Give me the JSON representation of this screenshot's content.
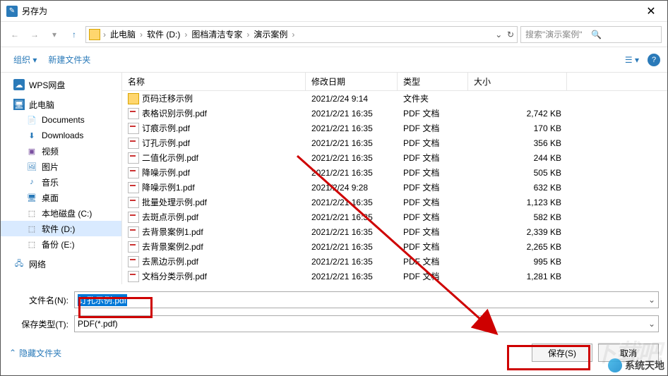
{
  "window": {
    "title": "另存为"
  },
  "breadcrumb": {
    "items": [
      "此电脑",
      "软件 (D:)",
      "图档清洁专家",
      "演示案例"
    ]
  },
  "search": {
    "placeholder": "搜索\"演示案例\""
  },
  "toolbar": {
    "organize": "组织",
    "newFolder": "新建文件夹"
  },
  "sidebar": {
    "wps": "WPS网盘",
    "pc": "此电脑",
    "docs": "Documents",
    "dl": "Downloads",
    "vid": "视频",
    "pic": "图片",
    "mus": "音乐",
    "desk": "桌面",
    "diskC": "本地磁盘 (C:)",
    "diskD": "软件 (D:)",
    "diskE": "备份 (E:)",
    "net": "网络"
  },
  "columns": {
    "name": "名称",
    "date": "修改日期",
    "type": "类型",
    "size": "大小"
  },
  "files": [
    {
      "icon": "folder",
      "name": "页码迁移示例",
      "date": "2021/2/24 9:14",
      "type": "文件夹",
      "size": ""
    },
    {
      "icon": "pdf",
      "name": "表格识别示例.pdf",
      "date": "2021/2/21 16:35",
      "type": "PDF 文档",
      "size": "2,742 KB"
    },
    {
      "icon": "pdf",
      "name": "订痕示例.pdf",
      "date": "2021/2/21 16:35",
      "type": "PDF 文档",
      "size": "170 KB"
    },
    {
      "icon": "pdf",
      "name": "订孔示例.pdf",
      "date": "2021/2/21 16:35",
      "type": "PDF 文档",
      "size": "356 KB"
    },
    {
      "icon": "pdf",
      "name": "二值化示例.pdf",
      "date": "2021/2/21 16:35",
      "type": "PDF 文档",
      "size": "244 KB"
    },
    {
      "icon": "pdf",
      "name": "降噪示例.pdf",
      "date": "2021/2/21 16:35",
      "type": "PDF 文档",
      "size": "505 KB"
    },
    {
      "icon": "pdf",
      "name": "降噪示例1.pdf",
      "date": "2021/2/24 9:28",
      "type": "PDF 文档",
      "size": "632 KB"
    },
    {
      "icon": "pdf",
      "name": "批量处理示例.pdf",
      "date": "2021/2/21 16:35",
      "type": "PDF 文档",
      "size": "1,123 KB"
    },
    {
      "icon": "pdf",
      "name": "去斑点示例.pdf",
      "date": "2021/2/21 16:35",
      "type": "PDF 文档",
      "size": "582 KB"
    },
    {
      "icon": "pdf",
      "name": "去背景案例1.pdf",
      "date": "2021/2/21 16:35",
      "type": "PDF 文档",
      "size": "2,339 KB"
    },
    {
      "icon": "pdf",
      "name": "去背景案例2.pdf",
      "date": "2021/2/21 16:35",
      "type": "PDF 文档",
      "size": "2,265 KB"
    },
    {
      "icon": "pdf",
      "name": "去黑边示例.pdf",
      "date": "2021/2/21 16:35",
      "type": "PDF 文档",
      "size": "995 KB"
    },
    {
      "icon": "pdf",
      "name": "文档分类示例.pdf",
      "date": "2021/2/21 16:35",
      "type": "PDF 文档",
      "size": "1,281 KB"
    }
  ],
  "fields": {
    "filenameLabel": "文件名(N):",
    "filenameValue": "订孔示例.pdf",
    "typeLabel": "保存类型(T):",
    "typeValue": "PDF(*.pdf)"
  },
  "actions": {
    "hideFolders": "隐藏文件夹",
    "save": "保存(S)",
    "cancel": "取消"
  },
  "watermark": {
    "label": "系统天地",
    "bg": "下载吧"
  }
}
